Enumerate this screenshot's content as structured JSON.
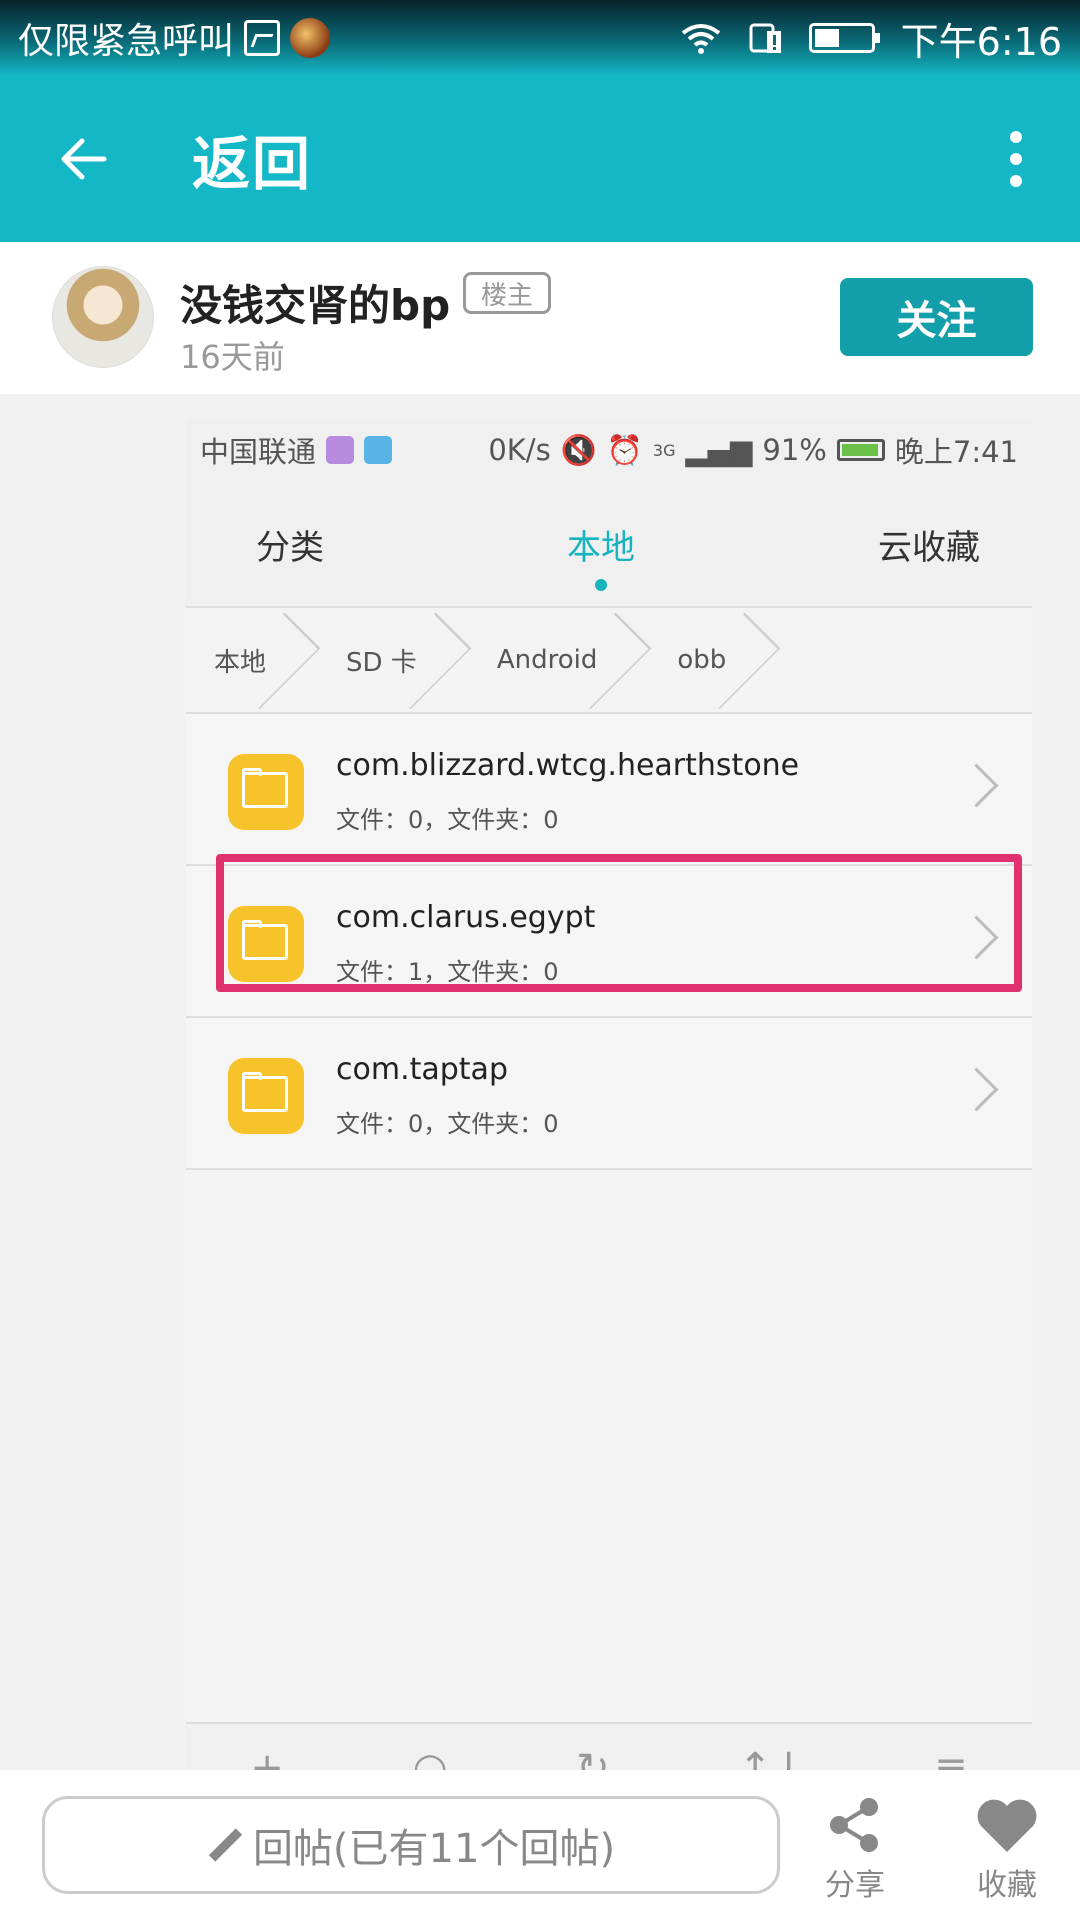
{
  "status_bar": {
    "carrier": "仅限紧急呼叫",
    "time": "下午6:16"
  },
  "app_bar": {
    "title": "返回"
  },
  "author": {
    "name": "没钱交肾的bp",
    "badge": "楼主",
    "time": "16天前",
    "follow_label": "关注"
  },
  "screenshot": {
    "status": {
      "carrier": "中国联通",
      "speed": "0K/s",
      "network": "3G",
      "battery": "91%",
      "time": "晚上7:41"
    },
    "tabs": [
      {
        "label": "分类",
        "active": false
      },
      {
        "label": "本地",
        "active": true
      },
      {
        "label": "云收藏",
        "active": false
      }
    ],
    "breadcrumbs": [
      "本地",
      "SD 卡",
      "Android",
      "obb"
    ],
    "folders": [
      {
        "name": "com.blizzard.wtcg.hearthstone",
        "meta": "文件：0，文件夹：0"
      },
      {
        "name": "com.clarus.egypt",
        "meta": "文件：1，文件夹：0",
        "highlighted": true
      },
      {
        "name": "com.taptap",
        "meta": "文件：0，文件夹：0"
      }
    ],
    "bottom_toolbar": [
      "+",
      "○",
      "↻",
      "↑↓",
      "≡"
    ]
  },
  "bottom_bar": {
    "reply_placeholder": "回帖(已有11个回帖)",
    "share_label": "分享",
    "favorite_label": "收藏"
  },
  "colors": {
    "accent": "#13b7c6",
    "highlight": "#e0326f",
    "folder": "#f7c32b"
  }
}
